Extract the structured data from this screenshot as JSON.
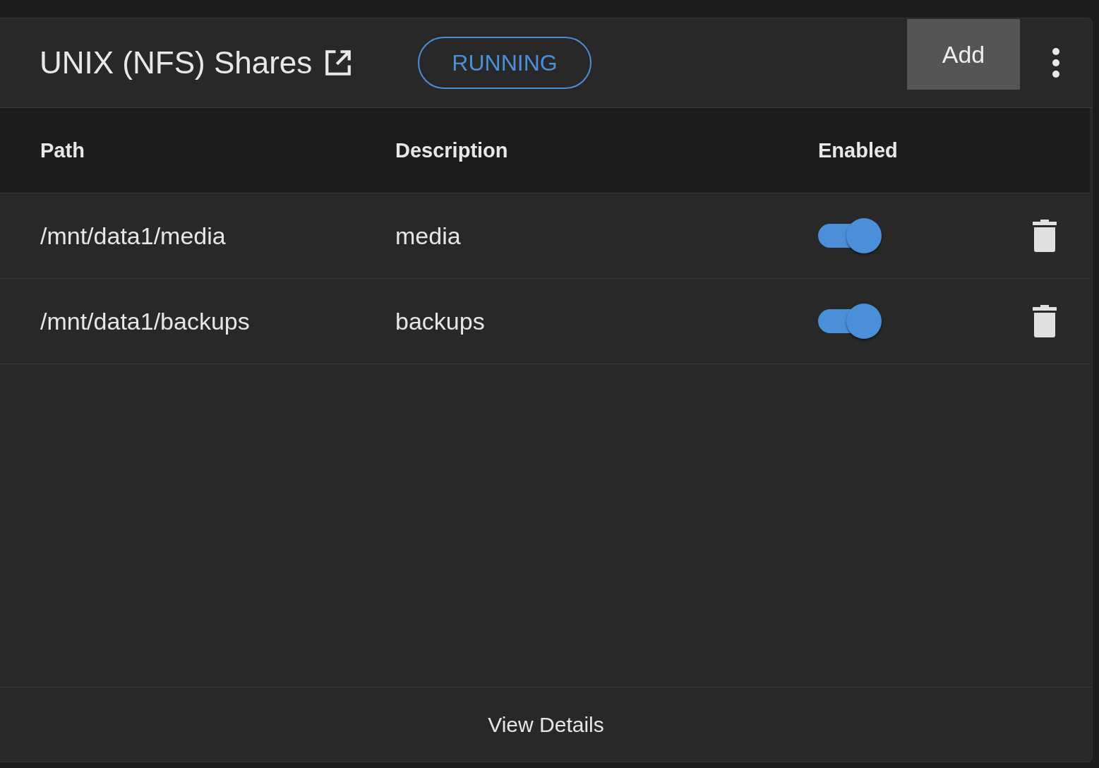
{
  "card": {
    "title": "UNIX (NFS) Shares",
    "status": "RUNNING",
    "add_button": "Add"
  },
  "table": {
    "columns": [
      "Path",
      "Description",
      "Enabled"
    ],
    "rows": [
      {
        "path": "/mnt/data1/media",
        "description": "media",
        "enabled": true
      },
      {
        "path": "/mnt/data1/backups",
        "description": "backups",
        "enabled": true
      }
    ]
  },
  "footer": {
    "link": "View Details"
  }
}
